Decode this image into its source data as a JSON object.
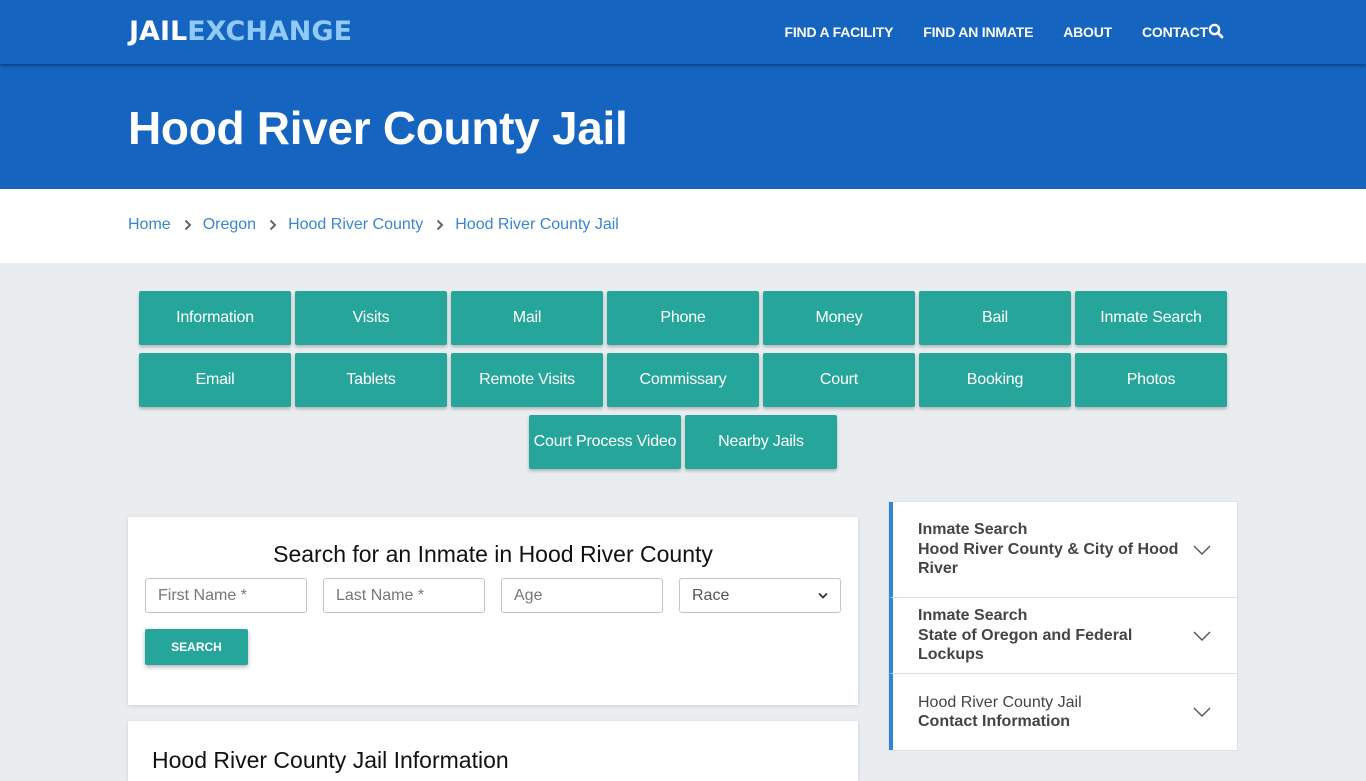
{
  "navbar": {
    "logo_part1": "JAIL",
    "logo_part2": "EXCHANGE",
    "links": [
      "FIND A FACILITY",
      "FIND AN INMATE",
      "ABOUT",
      "CONTACT"
    ],
    "search_icon": "search-icon"
  },
  "hero": {
    "title": "Hood River County Jail"
  },
  "breadcrumb": [
    "Home",
    "Oregon",
    "Hood River County",
    "Hood River County Jail"
  ],
  "tiles": {
    "row1": [
      "Information",
      "Visits",
      "Mail",
      "Phone",
      "Money",
      "Bail",
      "Inmate Search"
    ],
    "row2": [
      "Email",
      "Tablets",
      "Remote Visits",
      "Commissary",
      "Court",
      "Booking",
      "Photos"
    ],
    "row3": [
      "Court Process Video",
      "Nearby Jails"
    ]
  },
  "search_form": {
    "title": "Search for an Inmate in Hood River County",
    "first_name_placeholder": "First Name *",
    "last_name_placeholder": "Last Name *",
    "age_placeholder": "Age",
    "race_selected": "Race",
    "submit_label": "SEARCH"
  },
  "info_section": {
    "title": "Hood River County Jail Information"
  },
  "sidebar": {
    "items": [
      {
        "line1": "Inmate Search",
        "line2": "Hood River County & City of Hood River"
      },
      {
        "line1": "Inmate Search",
        "line2": "State of Oregon and Federal Lockups"
      },
      {
        "line1": "Hood River County Jail",
        "line2": "Contact Information"
      }
    ]
  },
  "colors": {
    "brand_blue": "#1565c0",
    "logo_accent": "#90caf9",
    "tile_teal": "#26a69a",
    "link_blue": "#3a86d3",
    "sidebar_accent": "#2f86d9",
    "page_bg": "#eaedf0"
  }
}
